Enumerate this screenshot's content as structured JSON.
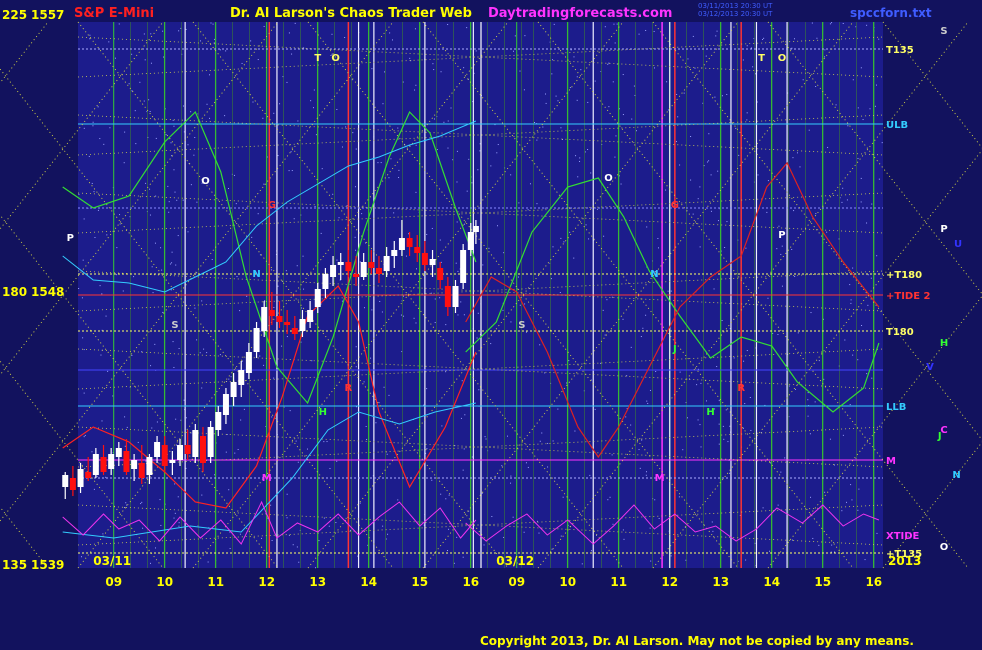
{
  "header": {
    "instrument": "S&P E-Mini",
    "title": "Dr. Al Larson's Chaos Trader Web",
    "website": "Daytradingforecasts.com",
    "timestamp_line1": "03/11/2013 20:30 UT",
    "timestamp_line2": "03/12/2013 20:30 UT",
    "file": "spccforn.txt"
  },
  "footer": {
    "copyright": "Copyright 2013, Dr. Al Larson. May not be copied by any means."
  },
  "colors": {
    "background": "#12125e",
    "plot_background": "#1c1c8c",
    "price_up": "#ffffff",
    "price_down": "#ff1010",
    "axis_text": "#ffff00",
    "title_red": "#ff2020",
    "title_magenta": "#ff33ff",
    "grid_green": "#33cc33",
    "grid_blue": "#3333ff",
    "cyan": "#33ccff"
  },
  "chart_data": {
    "type": "candlestick",
    "y_axis_labels": [
      {
        "angle": "225",
        "price": "1557",
        "value": 1557
      },
      {
        "angle": "180",
        "price": "1548",
        "value": 1548
      },
      {
        "angle": "135",
        "price": "1539",
        "value": 1539
      }
    ],
    "ylim": [
      1539,
      1557
    ],
    "date_labels": [
      "03/11",
      "03/12"
    ],
    "year_label": "2013",
    "x_ticks": [
      "09",
      "10",
      "11",
      "12",
      "13",
      "14",
      "15",
      "16",
      "09",
      "10",
      "11",
      "12",
      "13",
      "14",
      "15",
      "16"
    ],
    "right_labels": [
      {
        "text": "T135",
        "price": 1556.1,
        "color": "#ffff66"
      },
      {
        "text": "ULB",
        "price": 1553.6,
        "color": "#33ccff"
      },
      {
        "text": "+T180",
        "price": 1548.6,
        "color": "#ffff66"
      },
      {
        "text": "+TIDE 2",
        "price": 1547.9,
        "color": "#ff3333"
      },
      {
        "text": "T180",
        "price": 1546.7,
        "color": "#ffff66"
      },
      {
        "text": "LLB",
        "price": 1544.2,
        "color": "#33ccff"
      },
      {
        "text": "M",
        "price": 1542.4,
        "color": "#ff33ff"
      },
      {
        "text": "XTIDE",
        "price": 1539.9,
        "color": "#ff33ff"
      },
      {
        "text": "+T135",
        "price": 1539.3,
        "color": "#ffff66"
      }
    ],
    "planet_labels": [
      {
        "text": "T",
        "x": 13.0,
        "y": 1555.7,
        "color": "#ffff66",
        "day": 1
      },
      {
        "text": "O",
        "x": 13.35,
        "y": 1555.7,
        "color": "#ffff66",
        "day": 1
      },
      {
        "text": "O",
        "x": 10.8,
        "y": 1551.6,
        "color": "#ffffff",
        "day": 1
      },
      {
        "text": "P",
        "x": 8.15,
        "y": 1549.7,
        "color": "#ffffff",
        "day": 1
      },
      {
        "text": "G",
        "x": 12.1,
        "y": 1550.8,
        "color": "#ff3333",
        "day": 1
      },
      {
        "text": "N",
        "x": 11.8,
        "y": 1548.5,
        "color": "#33ccff",
        "day": 1
      },
      {
        "text": "S",
        "x": 10.2,
        "y": 1546.8,
        "color": "#cccccc",
        "day": 1
      },
      {
        "text": "R",
        "x": 13.6,
        "y": 1544.7,
        "color": "#ff3333",
        "day": 1
      },
      {
        "text": "H",
        "x": 13.1,
        "y": 1543.9,
        "color": "#33ff33",
        "day": 1
      },
      {
        "text": "M",
        "x": 12.0,
        "y": 1541.7,
        "color": "#ff33ff",
        "day": 1
      },
      {
        "text": "T",
        "x": 13.8,
        "y": 1555.7,
        "color": "#ffff66",
        "day": 2
      },
      {
        "text": "O",
        "x": 14.2,
        "y": 1555.7,
        "color": "#ffff66",
        "day": 2
      },
      {
        "text": "O",
        "x": 10.8,
        "y": 1551.7,
        "color": "#ffffff",
        "day": 2
      },
      {
        "text": "G",
        "x": 12.1,
        "y": 1550.8,
        "color": "#ff3333",
        "day": 2
      },
      {
        "text": "P",
        "x": 14.2,
        "y": 1549.8,
        "color": "#ffffff",
        "day": 2
      },
      {
        "text": "N",
        "x": 11.7,
        "y": 1548.5,
        "color": "#33ccff",
        "day": 2
      },
      {
        "text": "S",
        "x": 9.1,
        "y": 1546.8,
        "color": "#cccccc",
        "day": 2
      },
      {
        "text": "J",
        "x": 12.1,
        "y": 1546.0,
        "color": "#33ff33",
        "day": 2
      },
      {
        "text": "R",
        "x": 13.4,
        "y": 1544.7,
        "color": "#ff3333",
        "day": 2
      },
      {
        "text": "H",
        "x": 12.8,
        "y": 1543.9,
        "color": "#33ff33",
        "day": 2
      },
      {
        "text": "M",
        "x": 11.8,
        "y": 1541.7,
        "color": "#ff33ff",
        "day": 2
      }
    ],
    "outside_labels": [
      {
        "text": "S",
        "y": 1556.6,
        "color": "#cccccc",
        "col": 1
      },
      {
        "text": "P",
        "y": 1550.0,
        "color": "#ffffff",
        "col": 1
      },
      {
        "text": "U",
        "y": 1549.5,
        "color": "#3333ff",
        "col": 2
      },
      {
        "text": "V",
        "y": 1545.4,
        "color": "#3333ff",
        "col": 0
      },
      {
        "text": "H",
        "y": 1546.2,
        "color": "#33ff33",
        "col": 1
      },
      {
        "text": "J",
        "y": 1543.1,
        "color": "#33ff33",
        "col": 0.7
      },
      {
        "text": "C",
        "y": 1543.3,
        "color": "#ff33ff",
        "col": 1
      },
      {
        "text": "N",
        "y": 1541.8,
        "color": "#33ccff",
        "col": 1.9
      },
      {
        "text": "O",
        "y": 1539.4,
        "color": "#ffffff",
        "col": 1
      }
    ],
    "candles": [
      [
        8.05,
        1541.5,
        1542.0,
        1541.1,
        1541.9
      ],
      [
        8.2,
        1541.8,
        1542.2,
        1541.2,
        1541.4
      ],
      [
        8.35,
        1541.5,
        1542.3,
        1541.3,
        1542.1
      ],
      [
        8.5,
        1542.0,
        1542.5,
        1541.7,
        1541.8
      ],
      [
        8.65,
        1541.9,
        1542.8,
        1541.8,
        1542.6
      ],
      [
        8.8,
        1542.5,
        1542.9,
        1541.9,
        1542.0
      ],
      [
        8.95,
        1542.1,
        1542.8,
        1541.9,
        1542.6
      ],
      [
        9.1,
        1542.5,
        1543.0,
        1542.2,
        1542.8
      ],
      [
        9.25,
        1542.7,
        1543.1,
        1541.9,
        1542.0
      ],
      [
        9.4,
        1542.1,
        1542.6,
        1541.7,
        1542.4
      ],
      [
        9.55,
        1542.3,
        1542.9,
        1541.6,
        1541.8
      ],
      [
        9.7,
        1541.9,
        1542.6,
        1541.6,
        1542.5
      ],
      [
        9.85,
        1542.5,
        1543.2,
        1542.3,
        1543.0
      ],
      [
        10.0,
        1542.9,
        1543.2,
        1542.0,
        1542.2
      ],
      [
        10.15,
        1542.3,
        1542.7,
        1541.9,
        1542.4
      ],
      [
        10.3,
        1542.4,
        1543.1,
        1542.2,
        1542.9
      ],
      [
        10.45,
        1542.9,
        1543.4,
        1542.4,
        1542.6
      ],
      [
        10.6,
        1542.5,
        1543.6,
        1542.3,
        1543.4
      ],
      [
        10.75,
        1543.2,
        1543.5,
        1542.0,
        1542.3
      ],
      [
        10.9,
        1542.5,
        1543.7,
        1542.3,
        1543.5
      ],
      [
        11.05,
        1543.4,
        1544.2,
        1543.2,
        1544.0
      ],
      [
        11.2,
        1543.9,
        1544.8,
        1543.6,
        1544.6
      ],
      [
        11.35,
        1544.5,
        1545.3,
        1544.2,
        1545.0
      ],
      [
        11.5,
        1544.9,
        1545.7,
        1544.5,
        1545.4
      ],
      [
        11.65,
        1545.3,
        1546.3,
        1545.1,
        1546.0
      ],
      [
        11.8,
        1546.0,
        1547.0,
        1545.8,
        1546.8
      ],
      [
        11.95,
        1546.7,
        1547.7,
        1546.5,
        1547.5
      ],
      [
        12.1,
        1547.4,
        1548.0,
        1546.9,
        1547.2
      ],
      [
        12.25,
        1547.2,
        1547.7,
        1546.8,
        1547.0
      ],
      [
        12.4,
        1547.0,
        1547.4,
        1546.6,
        1546.9
      ],
      [
        12.55,
        1546.8,
        1547.2,
        1546.4,
        1546.6
      ],
      [
        12.7,
        1546.7,
        1547.4,
        1546.5,
        1547.1
      ],
      [
        12.85,
        1547.0,
        1547.7,
        1546.8,
        1547.4
      ],
      [
        13.0,
        1547.5,
        1548.3,
        1547.3,
        1548.1
      ],
      [
        13.15,
        1548.1,
        1548.8,
        1547.8,
        1548.6
      ],
      [
        13.3,
        1548.5,
        1549.2,
        1548.2,
        1548.9
      ],
      [
        13.45,
        1548.9,
        1549.3,
        1548.4,
        1549.0
      ],
      [
        13.6,
        1549.0,
        1549.4,
        1548.5,
        1548.7
      ],
      [
        13.75,
        1548.6,
        1549.2,
        1548.2,
        1548.5
      ],
      [
        13.9,
        1548.5,
        1549.3,
        1548.4,
        1549.0
      ],
      [
        14.05,
        1549.0,
        1549.4,
        1548.6,
        1548.8
      ],
      [
        14.2,
        1548.8,
        1549.2,
        1548.3,
        1548.6
      ],
      [
        14.35,
        1548.7,
        1549.5,
        1548.5,
        1549.2
      ],
      [
        14.5,
        1549.2,
        1549.7,
        1548.8,
        1549.4
      ],
      [
        14.65,
        1549.4,
        1550.4,
        1549.2,
        1549.8
      ],
      [
        14.8,
        1549.8,
        1550.0,
        1549.2,
        1549.5
      ],
      [
        14.95,
        1549.5,
        1549.9,
        1549.0,
        1549.3
      ],
      [
        15.1,
        1549.3,
        1549.7,
        1548.7,
        1548.9
      ],
      [
        15.25,
        1548.9,
        1549.4,
        1548.5,
        1549.1
      ],
      [
        15.4,
        1548.8,
        1549.0,
        1548.1,
        1548.4
      ],
      [
        15.55,
        1548.2,
        1548.5,
        1547.2,
        1547.5
      ],
      [
        15.7,
        1547.5,
        1548.4,
        1547.3,
        1548.2
      ],
      [
        15.85,
        1548.3,
        1549.6,
        1548.1,
        1549.4
      ],
      [
        16.0,
        1549.4,
        1550.3,
        1549.2,
        1550.0
      ],
      [
        16.1,
        1550.0,
        1550.4,
        1549.6,
        1550.2
      ]
    ]
  }
}
